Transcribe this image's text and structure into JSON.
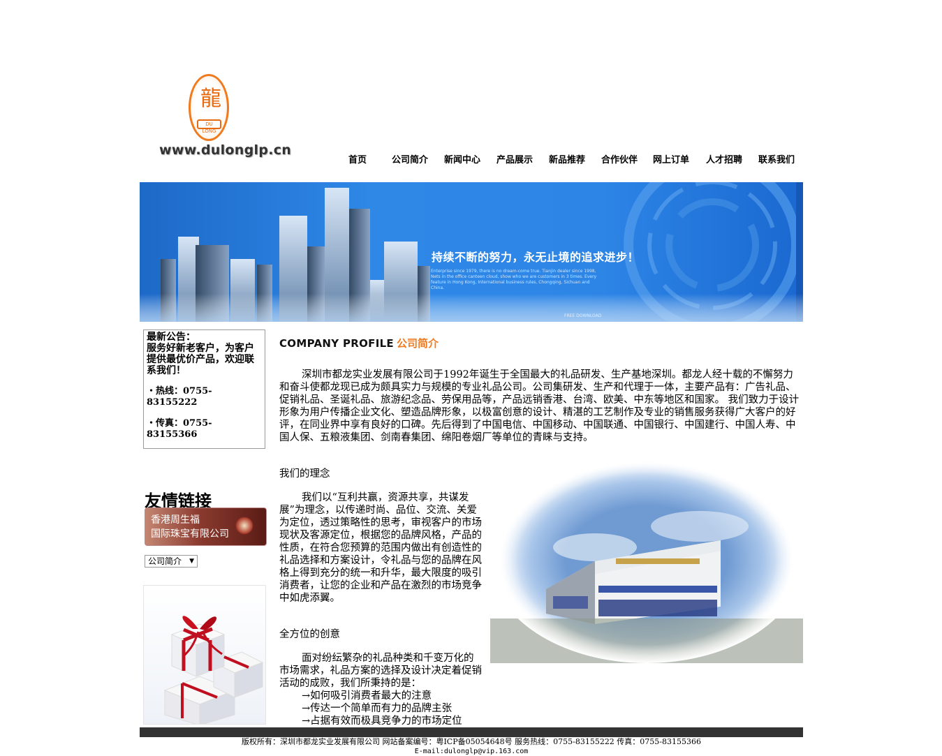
{
  "logo": {
    "url_text": "www.dulonglp.cn",
    "emblem_text": "DU LONG"
  },
  "nav": [
    "首页",
    "公司简介",
    "新闻中心",
    "产品展示",
    "新品推荐",
    "合作伙伴",
    "网上订单",
    "人才招聘",
    "联系我们"
  ],
  "banner": {
    "slogan": "持续不断的努力，永无止境的追求进步！",
    "fine_print": "Enterprise since 1979, there is no dream-come true. Tianjin dealer since 1998, Nets in the office canteen cloud, show who we are customers in 3 times. Every feature in Hong Kong, International business rules, Chongqing, Sichuan and China.",
    "free_download": "FREE DOWNLOAD"
  },
  "notice": {
    "title": "最新公告：",
    "message": "服务好新老客户，为客户提供最优价产品，欢迎联系我们！",
    "hotline": "・热线：0755-83155222",
    "fax": "・传真：0755-83155366"
  },
  "links": {
    "title": "友情链接",
    "banner_line1": "香港周生福",
    "banner_line2": "国际珠宝有限公司",
    "select_value": "公司简介"
  },
  "main": {
    "title_en": "COMPANY PROFILE",
    "title_cn": "公司简介",
    "intro": "深圳市都龙实业发展有限公司于1992年诞生于全国最大的礼品研发、生产基地深圳。都龙人经十载的不懈努力和奋斗使都龙现已成为颇具实力与规模的专业礼品公司。公司集研发、生产和代理于一体，主要产品有：广告礼品、促销礼品、圣诞礼品、旅游纪念品、劳保用品等，产品远销香港、台湾、欧美、中东等地区和国家。 我们致力于设计形象为用户传播企业文化、塑造品牌形象，以极富创意的设计、精湛的工艺制作及专业的销售服务获得广大客户的好评，在同业界中享有良好的口碑。先后得到了中国电信、中国移动、中国联通、中国银行、中国建行、中国人寿、中国人保、五粮液集团、剑南春集团、绵阳卷烟厂等单位的青睐与支持。",
    "heading2": "我们的理念",
    "para2": "我们以“互利共赢，资源共享，共谋发展”为理念，以传递时尚、品位、交流、关爱为定位，透过策略性的思考，审视客户的市场现状及客源定位，根据您的品牌风格，产品的性质，在符合您预算的范围内做出有创造性的礼品选择和方案设计，令礼品与您的品牌在风格上得到充分的统一和升华，最大限度的吸引消费者，让您的企业和产品在激烈的市场竞争中如虎添翼。",
    "heading3": "全方位的创意",
    "para3": "面对纷纭繁杂的礼品种类和千变万化的市场需求，礼品方案的选择及设计决定着促销活动的成败，我们所秉持的是：",
    "bullets": [
      "→如何吸引消费者最大的注意",
      "→传达一个简单而有力的品牌主张",
      "→占据有效而极具竞争力的市场定位"
    ]
  },
  "footer": {
    "line1": "版权所有：深圳市都龙实业发展有限公司  网站备案编号：粤ICP备05054648号  服务热线：0755-83155222 传真：0755-83155366",
    "line2": "E-mail:dulonglp@vip.163.com"
  },
  "colors": {
    "accent": "#f07a1e",
    "banner_blue": "#2d85e6",
    "footer_bar": "#333333"
  }
}
